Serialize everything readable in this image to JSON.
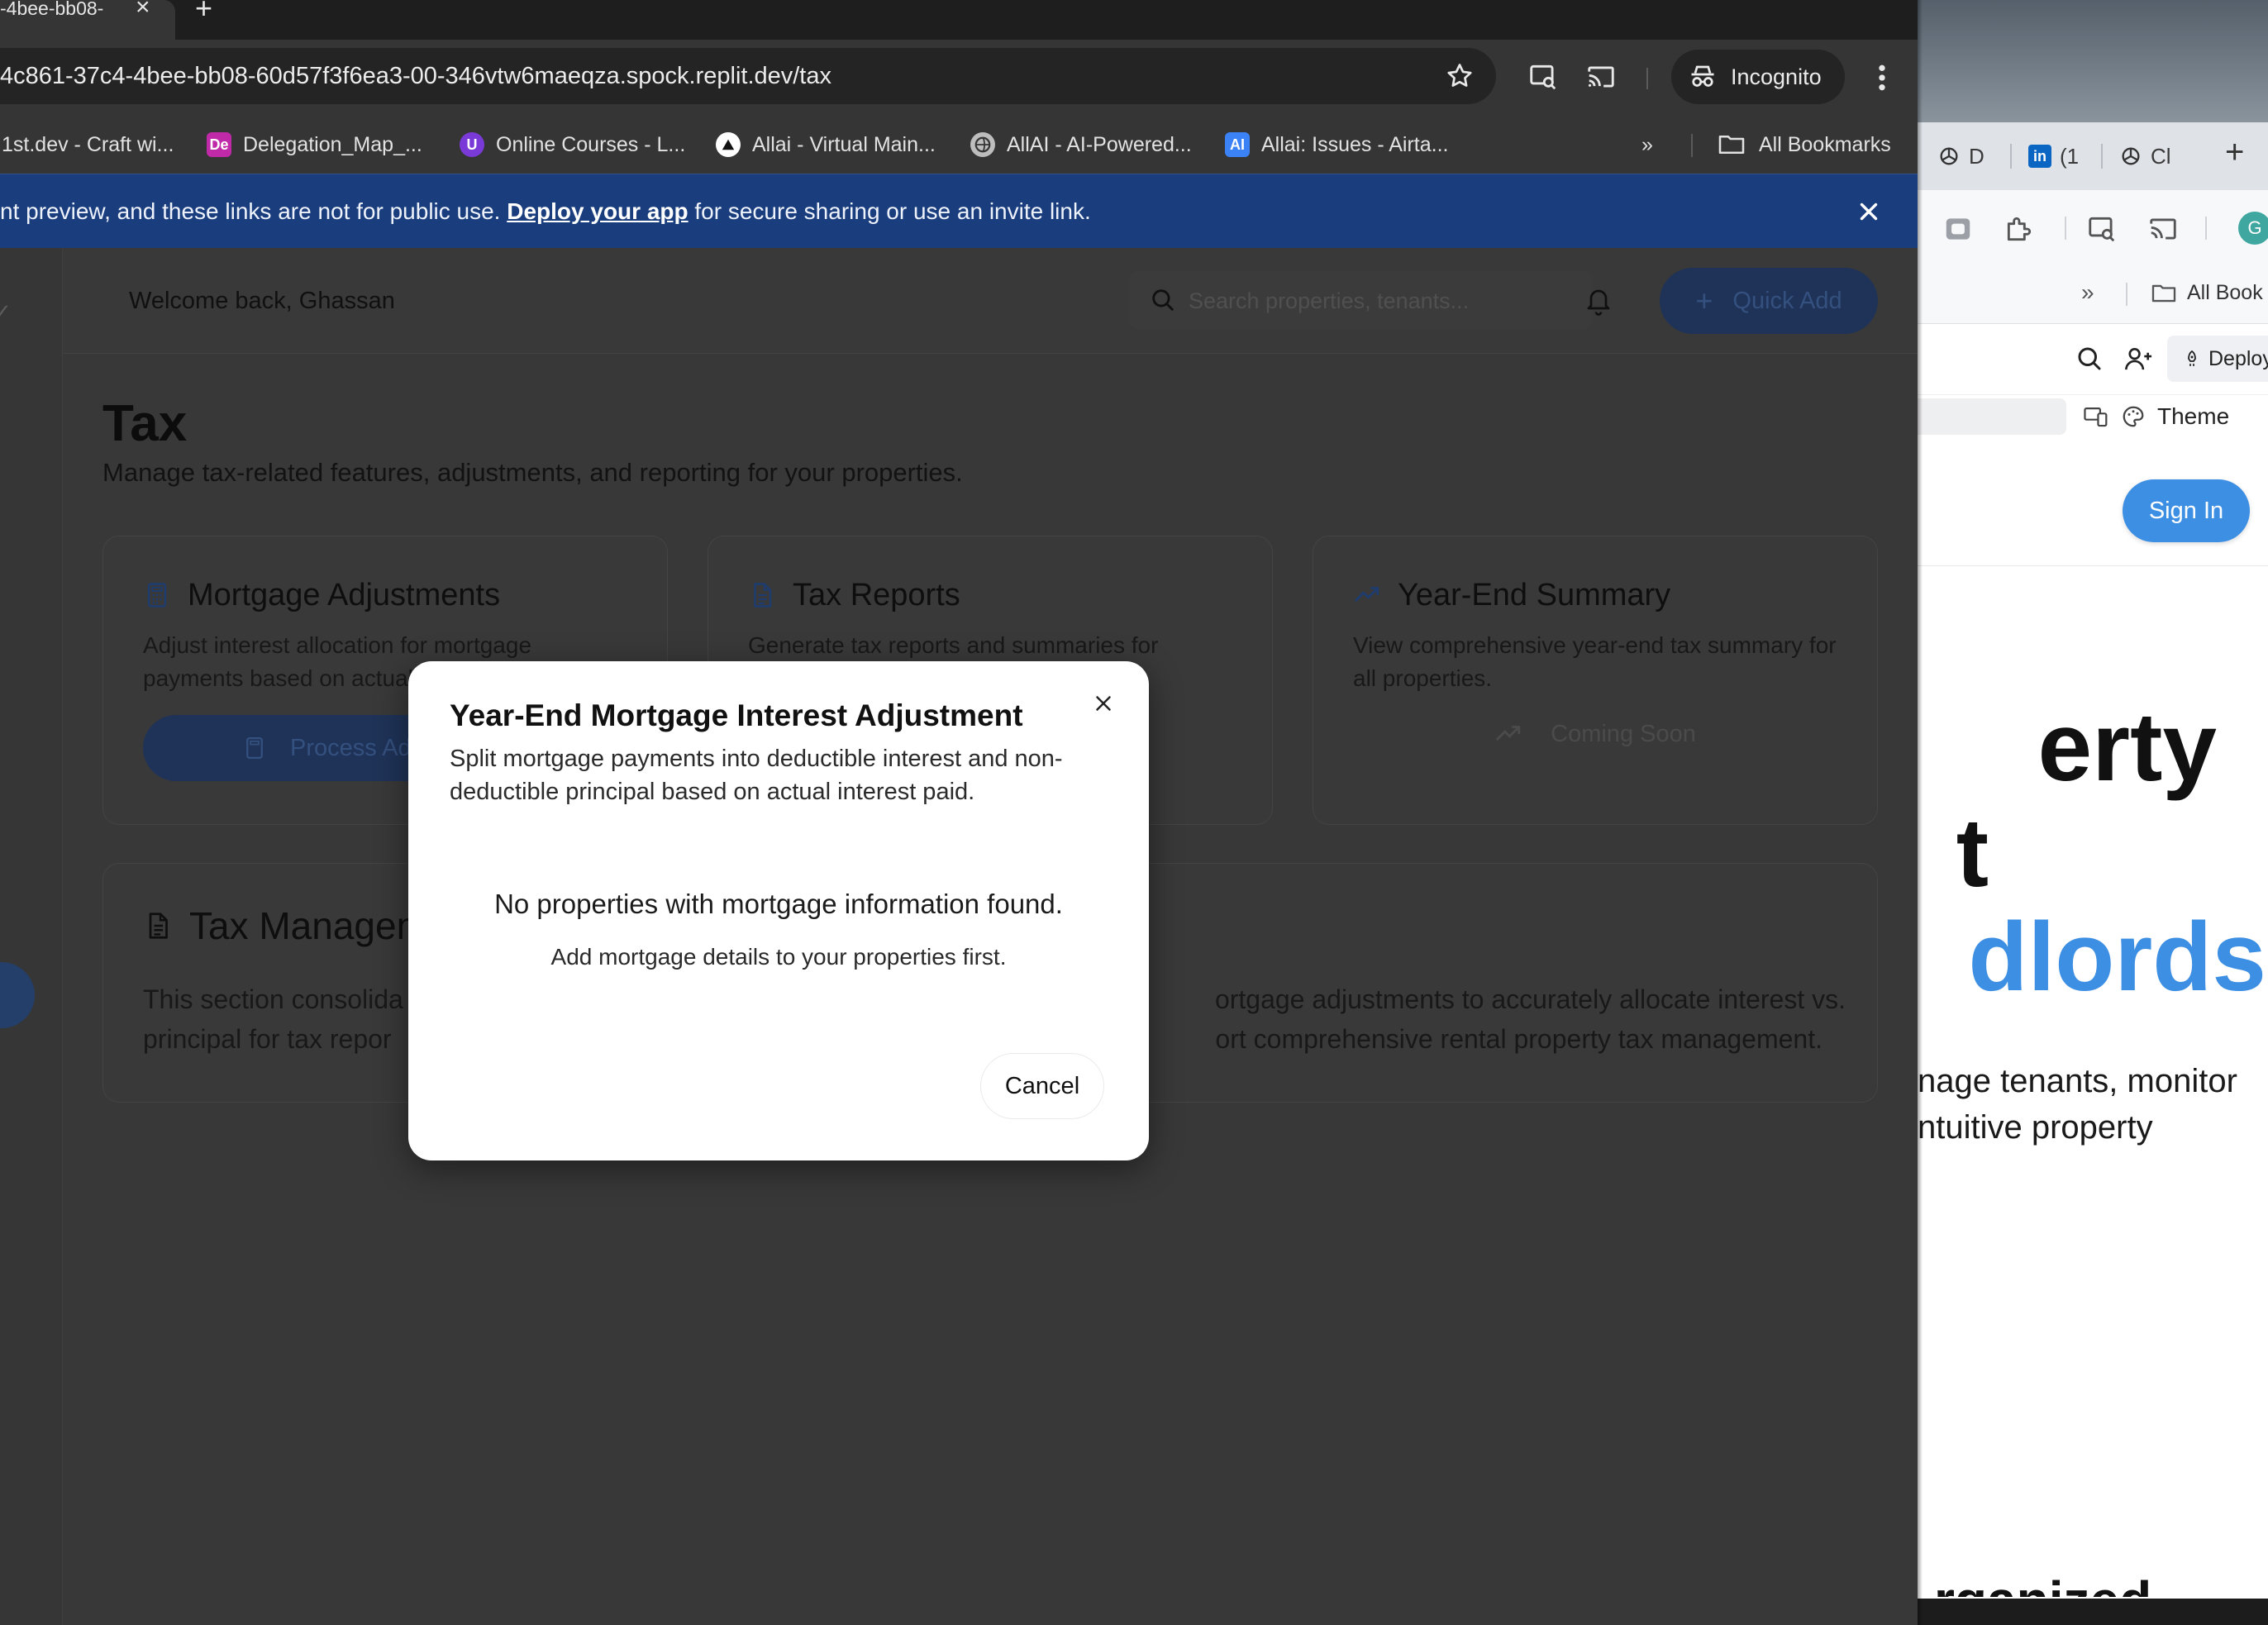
{
  "browser_left": {
    "tab_title": "-4bee-bb08-",
    "url": "4c861-37c4-4bee-bb08-60d57f3f6ea3-00-346vtw6maeqza.spock.replit.dev/tax",
    "incognito_label": "Incognito",
    "bookmarks": [
      {
        "label": "1st.dev - Craft wi...",
        "icon": "none",
        "color": ""
      },
      {
        "label": "Delegation_Map_...",
        "icon": "De",
        "color": "#c02aa8"
      },
      {
        "label": "Online Courses - L...",
        "icon": "U",
        "color": "#7a3ad8"
      },
      {
        "label": "Allai - Virtual Main...",
        "icon": "triangle",
        "color": "#ffffff"
      },
      {
        "label": "AllAI - AI-Powered...",
        "icon": "globe",
        "color": "#bdbdbd"
      },
      {
        "label": "Allai: Issues - Airta...",
        "icon": "AI",
        "color": "#3b82f6"
      }
    ],
    "all_bookmarks": "All Bookmarks"
  },
  "banner": {
    "text_before": "nt preview, and these links are not for public use. ",
    "link": "Deploy your app",
    "text_after": " for secure sharing or use an invite link."
  },
  "header": {
    "welcome": "Welcome back, Ghassan",
    "search_placeholder": "Search properties, tenants...",
    "quick_add": "Quick Add"
  },
  "page": {
    "title": "Tax",
    "subtitle": "Manage tax-related features, adjustments, and reporting for your properties."
  },
  "cards": [
    {
      "title": "Mortgage Adjustments",
      "description": "Adjust interest allocation for mortgage payments based on actual interest paid.",
      "button": "Process Adjustments",
      "icon": "calculator-icon"
    },
    {
      "title": "Tax Reports",
      "description": "Generate tax reports and summaries for",
      "icon": "file-text-icon"
    },
    {
      "title": "Year-End Summary",
      "description": "View comprehensive year-end tax summary for all properties.",
      "status": "Coming Soon",
      "icon": "trending-up-icon"
    }
  ],
  "management": {
    "title": "Tax Management",
    "line1_start": "This section consolida",
    "line1_end": "ortgage adjustments to accurately allocate interest vs.",
    "line2_start": "principal for tax repor",
    "line2_end": "ort comprehensive rental property tax management."
  },
  "modal": {
    "title": "Year-End Mortgage Interest Adjustment",
    "description": "Split mortgage payments into deductible interest and non-deductible principal based on actual interest paid.",
    "empty_message": "No properties with mortgage information found.",
    "hint": "Add mortgage details to your properties first.",
    "cancel": "Cancel"
  },
  "browser_right": {
    "tabs": [
      {
        "label": "D",
        "icon": "openai-icon"
      },
      {
        "label": "(1",
        "icon": "linkedin-icon"
      },
      {
        "label": "Cl",
        "icon": "openai-icon"
      }
    ],
    "all_bookmarks": "All Book",
    "deploy": "Deploy",
    "theme": "Theme",
    "avatar_letter": "G",
    "sign_in": "Sign In",
    "hero_line1": "erty",
    "hero_line2": "t",
    "hero_line3": "dlords",
    "hero_sub1": "nage tenants, monitor",
    "hero_sub2": "ntuitive property",
    "partial_bottom": "rganized",
    "accent": "#3d8fe4"
  },
  "colors": {
    "banner_bg": "#1a3d7e",
    "modal_bg": "#ffffff",
    "app_dim_bg": "#383838"
  }
}
